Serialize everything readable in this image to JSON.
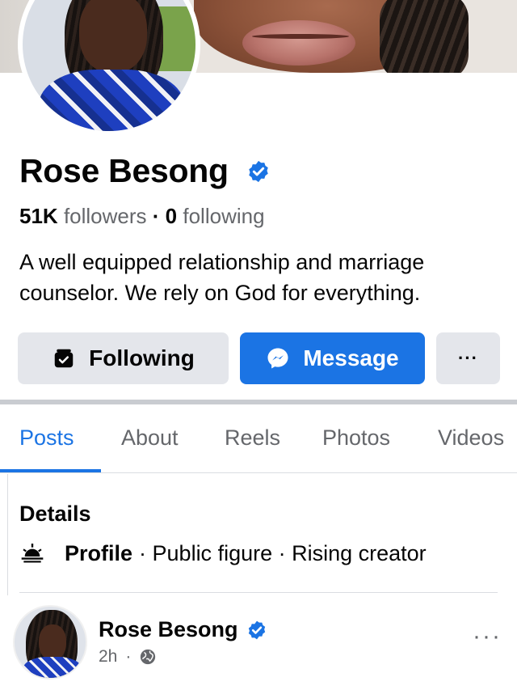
{
  "profile": {
    "name": "Rose Besong",
    "followers_count": "51K",
    "followers_label": "followers",
    "stats_separator": "·",
    "following_count": "0",
    "following_label": "following",
    "bio": "A well equipped relationship and marriage counselor. We rely on God for everything."
  },
  "actions": {
    "following_label": "Following",
    "message_label": "Message",
    "more_label": "···"
  },
  "tabs": [
    {
      "label": "Posts",
      "active": true
    },
    {
      "label": "About",
      "active": false
    },
    {
      "label": "Reels",
      "active": false
    },
    {
      "label": "Photos",
      "active": false
    },
    {
      "label": "Videos",
      "active": false
    }
  ],
  "details": {
    "title": "Details",
    "profile_label": "Profile",
    "category_text": "· Public figure · Rising creator"
  },
  "post": {
    "author": "Rose Besong",
    "time": "2h",
    "meta_separator": "·",
    "more_label": "···"
  },
  "colors": {
    "accent": "#1b74e4",
    "secondary_text": "#65676b",
    "button_gray": "#e4e6eb",
    "verified": "#1b74e4"
  },
  "icons": [
    "verified-badge-icon",
    "following-check-icon",
    "messenger-icon",
    "more-dots-icon",
    "profile-details-icon",
    "globe-icon"
  ]
}
